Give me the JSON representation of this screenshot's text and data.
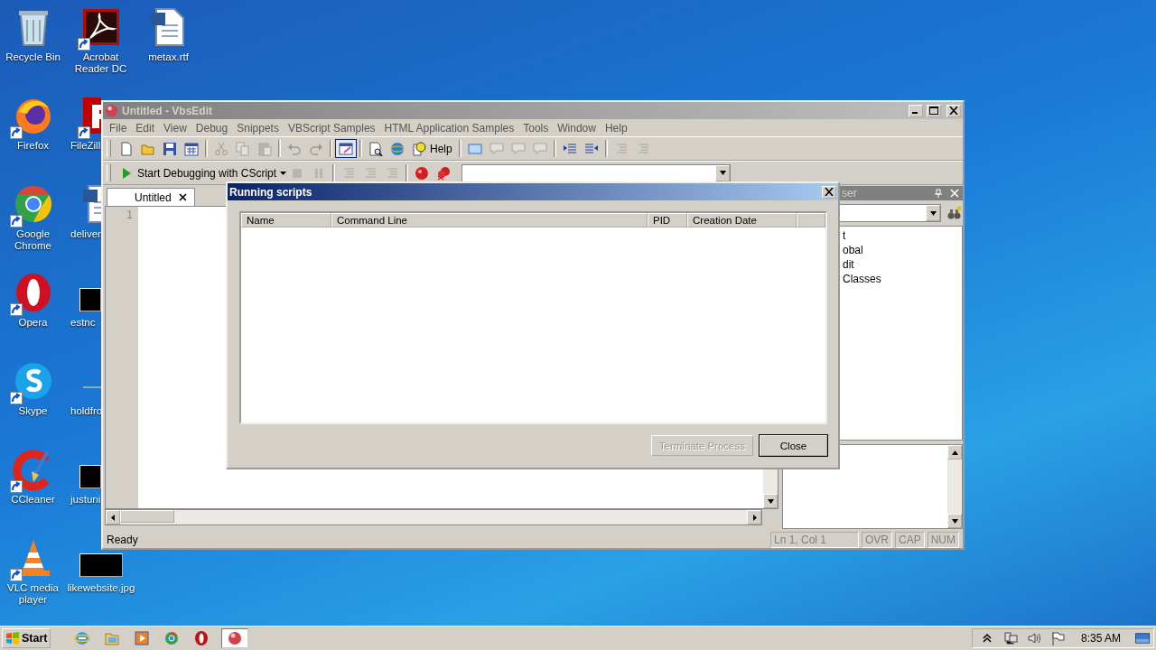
{
  "desktop": {
    "columns": [
      [
        {
          "label": "Recycle Bin",
          "kind": "bin",
          "shortcut": false,
          "cut_off": false
        },
        {
          "label": "Firefox",
          "kind": "fox",
          "shortcut": true,
          "cut_off": false
        },
        {
          "label": "Google Chrome",
          "kind": "chrome",
          "shortcut": true,
          "cut_off": false
        },
        {
          "label": "Opera",
          "kind": "opera",
          "shortcut": true,
          "cut_off": false
        },
        {
          "label": "Skype",
          "kind": "skype",
          "shortcut": true,
          "cut_off": false
        },
        {
          "label": "CCleaner",
          "kind": "cleaner",
          "shortcut": true,
          "cut_off": false
        },
        {
          "label": "VLC media player",
          "kind": "cone",
          "shortcut": true,
          "cut_off": false
        }
      ],
      [
        {
          "label": "Acrobat Reader DC",
          "kind": "pdf",
          "shortcut": true,
          "cut_off": false
        },
        {
          "label": "FileZill",
          "kind": "filezilla",
          "shortcut": true,
          "cut_off": true
        },
        {
          "label": "deliver",
          "kind": "doc",
          "shortcut": false,
          "cut_off": true
        },
        {
          "label": "estnc",
          "kind": "image",
          "shortcut": false,
          "cut_off": true
        },
        {
          "label": "holdfro",
          "kind": "blank",
          "shortcut": false,
          "cut_off": true
        },
        {
          "label": "justuni",
          "kind": "image",
          "shortcut": false,
          "cut_off": true
        },
        {
          "label": "likewebsite.jpg",
          "kind": "image",
          "shortcut": false,
          "cut_off": false
        }
      ],
      [
        {
          "label": "metax.rtf",
          "kind": "doc",
          "shortcut": false,
          "cut_off": false
        }
      ]
    ]
  },
  "window": {
    "title": "Untitled - VbsEdit",
    "active": false,
    "menu": [
      "File",
      "Edit",
      "View",
      "Debug",
      "Snippets",
      "VBScript Samples",
      "HTML Application Samples",
      "Tools",
      "Window",
      "Help"
    ],
    "toolbar": [
      {
        "kind": "new",
        "disabled": false,
        "pressed": false
      },
      {
        "kind": "open",
        "disabled": false,
        "pressed": false
      },
      {
        "kind": "save",
        "disabled": false,
        "pressed": false
      },
      {
        "kind": "saveall",
        "disabled": false,
        "pressed": false
      },
      {
        "kind": "sep"
      },
      {
        "kind": "cut",
        "disabled": true,
        "pressed": false
      },
      {
        "kind": "copy",
        "disabled": true,
        "pressed": false
      },
      {
        "kind": "paste",
        "disabled": true,
        "pressed": false
      },
      {
        "kind": "sep"
      },
      {
        "kind": "undo",
        "disabled": true,
        "pressed": false
      },
      {
        "kind": "redo",
        "disabled": true,
        "pressed": false
      },
      {
        "kind": "sep"
      },
      {
        "kind": "panel",
        "disabled": false,
        "pressed": true
      },
      {
        "kind": "sep"
      },
      {
        "kind": "preview",
        "disabled": false,
        "pressed": false
      },
      {
        "kind": "globe",
        "disabled": false,
        "pressed": false
      },
      {
        "kind": "help",
        "label": "Help",
        "disabled": false,
        "pressed": false
      },
      {
        "kind": "sep"
      },
      {
        "kind": "rect",
        "disabled": false,
        "pressed": false
      },
      {
        "kind": "bubble",
        "disabled": true,
        "pressed": false
      },
      {
        "kind": "bubble",
        "disabled": true,
        "pressed": false
      },
      {
        "kind": "bubble",
        "disabled": true,
        "pressed": false
      },
      {
        "kind": "sep"
      },
      {
        "kind": "indent",
        "disabled": false,
        "pressed": false
      },
      {
        "kind": "outdent",
        "disabled": false,
        "pressed": false
      },
      {
        "kind": "sep"
      },
      {
        "kind": "lines",
        "disabled": true,
        "pressed": false
      },
      {
        "kind": "lines",
        "disabled": true,
        "pressed": false
      }
    ],
    "debug_toolbar": [
      {
        "kind": "run",
        "label": "Start Debugging with CScript",
        "disabled": false,
        "pressed": false
      },
      {
        "kind": "stop",
        "disabled": true,
        "pressed": false
      },
      {
        "kind": "pause",
        "disabled": true,
        "pressed": false
      },
      {
        "kind": "sep"
      },
      {
        "kind": "lines",
        "disabled": true,
        "pressed": false
      },
      {
        "kind": "lines",
        "disabled": true,
        "pressed": false
      },
      {
        "kind": "lines",
        "disabled": true,
        "pressed": false
      },
      {
        "kind": "sep"
      },
      {
        "kind": "breakpoint",
        "disabled": false,
        "pressed": false
      },
      {
        "kind": "clearbp",
        "disabled": false,
        "pressed": false
      }
    ],
    "tabs": [
      {
        "label": "Untitled",
        "selected": true
      }
    ],
    "line_numbers": [
      "1"
    ],
    "side_panel": {
      "title": "ser",
      "tree": [
        "t",
        "obal",
        "dit",
        "Classes"
      ]
    },
    "status_bar": {
      "message": "Ready",
      "panes": [
        {
          "text": "Ln 1, Col 1",
          "on": false
        },
        {
          "text": "OVR",
          "on": false
        },
        {
          "text": "CAP",
          "on": false
        },
        {
          "text": "NUM",
          "on": false
        }
      ]
    }
  },
  "dialog": {
    "title": "Running scripts",
    "columns": [
      "Name",
      "Command Line",
      "PID",
      "Creation Date"
    ],
    "buttons": [
      {
        "label": "Terminate Process",
        "disabled": true
      },
      {
        "label": "Close",
        "disabled": false
      }
    ]
  },
  "taskbar": {
    "start": "Start",
    "items": [
      {
        "kind": "ie",
        "active": false
      },
      {
        "kind": "folder",
        "active": false
      },
      {
        "kind": "player",
        "active": false
      },
      {
        "kind": "chrome",
        "active": false
      },
      {
        "kind": "opera",
        "active": false
      },
      {
        "kind": "ball",
        "active": true
      }
    ],
    "clock": "8:35 AM"
  }
}
